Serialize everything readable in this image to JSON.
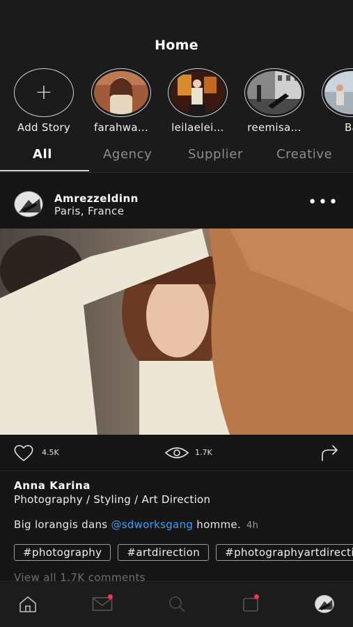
{
  "header": {
    "title": "Home"
  },
  "stories": [
    {
      "label": "Add Story",
      "type": "add"
    },
    {
      "label": "farahwa..."
    },
    {
      "label": "leilaelei..."
    },
    {
      "label": "reemisa..."
    },
    {
      "label": "Ba"
    }
  ],
  "tabs": [
    {
      "label": "All",
      "active": true
    },
    {
      "label": "Agency"
    },
    {
      "label": "Supplier"
    },
    {
      "label": "Creative"
    }
  ],
  "post": {
    "username": "Amrezzeldinn",
    "location": "Paris, France",
    "likes": "4.5K",
    "views": "1.7K",
    "caption_name": "Anna Karina",
    "caption_role": "Photography / Styling / Art Direction",
    "caption_text_before": "Big lorangis dans ",
    "caption_mention": "@sdworksgang",
    "caption_text_after": " homme.",
    "caption_time": "4h",
    "hashtags": [
      "#photography",
      "#artdirection",
      "#photographyartdirection"
    ],
    "view_comments": "View all 1.7K comments"
  },
  "nav": {
    "items": [
      "home-icon",
      "mail-icon",
      "search-icon",
      "notifications-icon",
      "profile-avatar"
    ],
    "badge_color": "#ff2d55"
  },
  "colors": {
    "accent_link": "#3aa0ff",
    "background": "#161616"
  }
}
